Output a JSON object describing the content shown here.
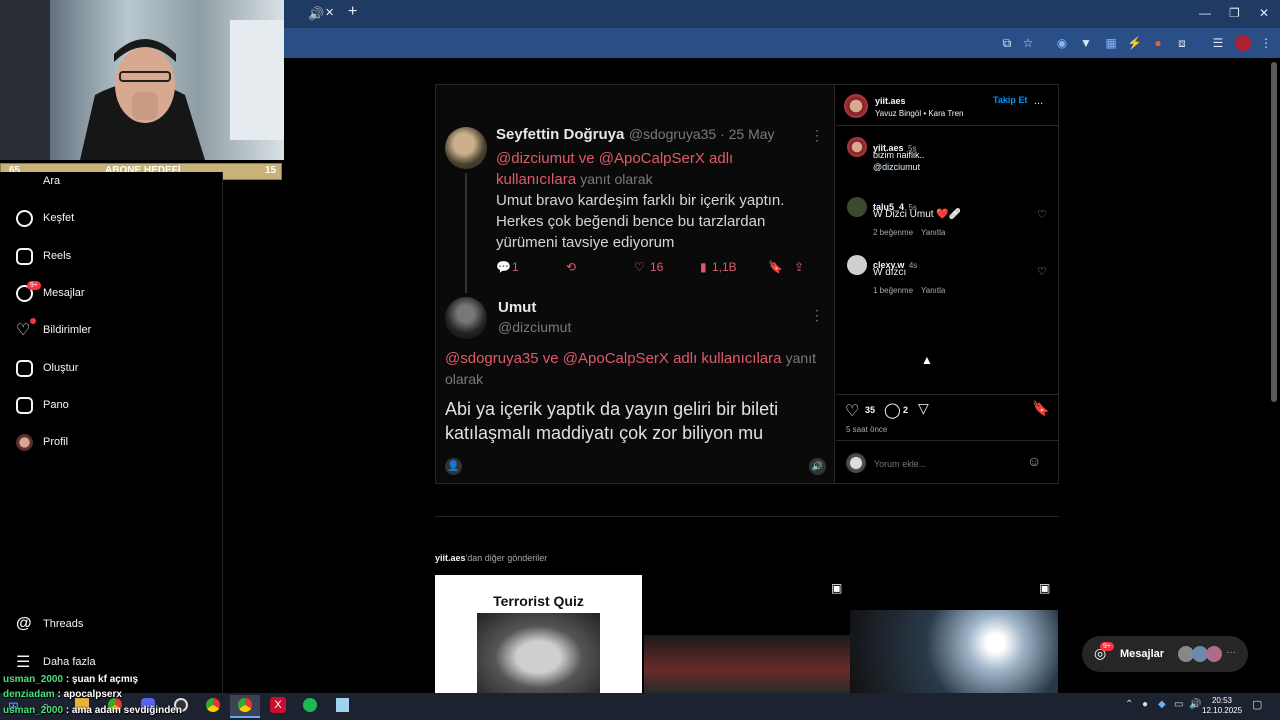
{
  "browser": {
    "colors": {
      "tabbar": "#1f3b63",
      "toolbar": "#2a4f86"
    },
    "tab": {
      "audio_icon": "speaker-icon",
      "close": "✕",
      "new_tab": "+"
    },
    "window_controls": [
      "minimize",
      "restore",
      "close"
    ],
    "toolbar_icons": [
      "screen-cast-icon",
      "star-icon",
      "extension-1-icon",
      "extension-2-icon",
      "extension-3-icon",
      "extension-4-icon",
      "extension-5-icon",
      "puzzle-icon",
      "reading-list-icon",
      "profile-icon",
      "menu-icon"
    ]
  },
  "stream": {
    "goal_bar": {
      "left_value": "65",
      "label": "ABONE HEDEFİ",
      "right_value": "15"
    },
    "chat": [
      {
        "user": "usman_2000",
        "message": " : şuan kf açmış"
      },
      {
        "user": "denziadam",
        "message": " : apocalpserx"
      },
      {
        "user": "usman_2000",
        "message": " : ama adam sevdiğinden"
      }
    ]
  },
  "sidebar": {
    "items": [
      {
        "label": "Ara",
        "icon": "search-icon"
      },
      {
        "label": "Keşfet",
        "icon": "compass-icon"
      },
      {
        "label": "Reels",
        "icon": "reels-icon"
      },
      {
        "label": "Mesajlar",
        "icon": "messenger-icon",
        "badge": "9+"
      },
      {
        "label": "Bildirimler",
        "icon": "heart-icon"
      },
      {
        "label": "Oluştur",
        "icon": "plus-square-icon"
      },
      {
        "label": "Pano",
        "icon": "dashboard-icon"
      },
      {
        "label": "Profil",
        "icon": "avatar"
      }
    ],
    "bottom": [
      {
        "label": "Threads",
        "icon": "threads-icon"
      },
      {
        "label": "Daha fazla",
        "icon": "hamburger-icon"
      }
    ]
  },
  "post": {
    "tweet1": {
      "name": "Seyfettin Doğruya",
      "handle": "@sdogruya35 · 25 May",
      "reply_mentions": "@dizciumut ve @ApoCalpSerX adlı kullanıcılara",
      "reply_suffix": "yanıt olarak",
      "body": "Umut bravo kardeşim farklı bir içerik yaptın. Herkes çok beğendi bence bu tarzlardan yürümeni tavsiye ediyorum",
      "replies": "1",
      "likes": "16",
      "views": "1,1B"
    },
    "tweet2": {
      "name": "Umut",
      "handle": "@dizciumut",
      "reply_mentions": "@sdogruya35 ve @ApoCalpSerX adlı kullanıcılara",
      "reply_suffix": "yanıt olarak",
      "body": "Abi ya içerik yaptık da yayın geliri bir bileti katılaşmalı maddiyatı çok zor biliyon mu"
    },
    "header": {
      "username": "yiit.aes",
      "subtitle": "Yavuz Bingöl • Kara Tren",
      "follow": "Takip Et",
      "more": "..."
    },
    "caption": {
      "username": "yiit.aes",
      "time": "5s",
      "text": "bizim naiflik..",
      "mention": "@dizciumut"
    },
    "comments": [
      {
        "username": "talu5_4",
        "time": "5s",
        "text": "W Dizci Umut ❤️🩹",
        "likes": "2 beğenme",
        "reply": "Yanıtla"
      },
      {
        "username": "clexy.w",
        "time": "4s",
        "text": "W dızcı",
        "likes": "1 beğenme",
        "reply": "Yanıtla"
      }
    ],
    "actions": {
      "likes": "35",
      "comments": "2"
    },
    "time_ago": "5 saat önce",
    "comment_placeholder": "Yorum ekle..."
  },
  "more_posts": {
    "title_user": "yiit.aes",
    "title_suffix": "'dan diğer gönderiler",
    "quiz_title": "Terrorist Quiz"
  },
  "messages_pill": {
    "label": "Mesajlar",
    "badge": "9+"
  },
  "taskbar": {
    "time": "20:53",
    "date": "12.10.2025",
    "apps": [
      "windows-start-icon",
      "search-icon",
      "file-explorer-icon",
      "chrome-icon",
      "discord-icon",
      "obs-icon",
      "chrome-icon",
      "chrome-icon",
      "x-app-icon",
      "spotify-icon",
      "notepad-icon"
    ]
  }
}
